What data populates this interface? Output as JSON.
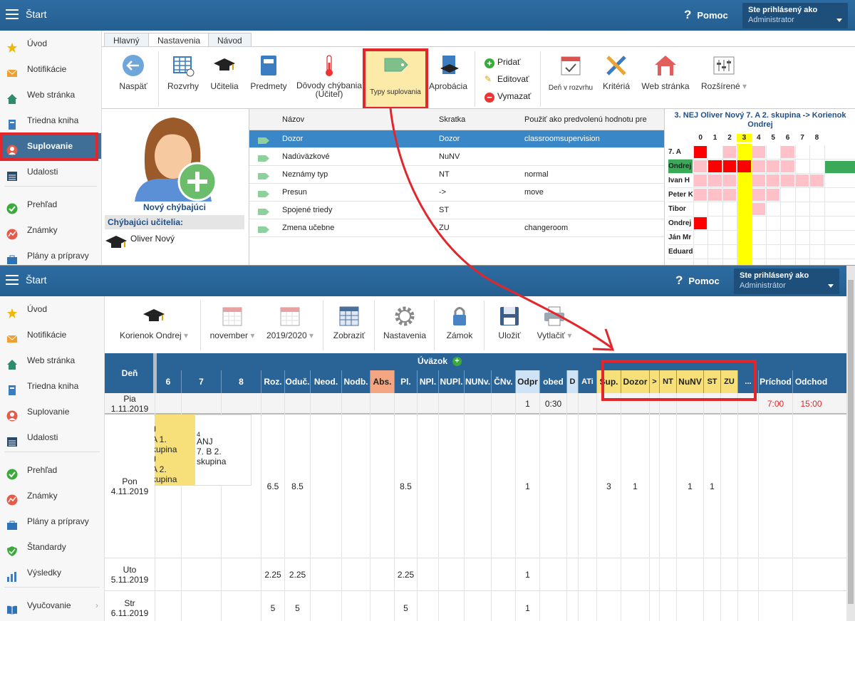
{
  "top": {
    "header": {
      "title": "Štart",
      "help": "Pomoc",
      "login_line1": "Ste prihlásený ako",
      "login_line2": "Administrator"
    },
    "sidebar": [
      {
        "label": "Úvod",
        "icon": "star-icon"
      },
      {
        "label": "Notifikácie",
        "icon": "envelope-icon"
      },
      {
        "label": "Web stránka",
        "icon": "home-icon"
      },
      {
        "label": "Triedna kniha",
        "icon": "book-icon"
      },
      {
        "label": "Suplovanie",
        "icon": "user-icon"
      },
      {
        "label": "Udalosti",
        "icon": "calendar-icon"
      },
      {
        "label": "Prehľad",
        "icon": "check-icon"
      },
      {
        "label": "Známky",
        "icon": "chart-icon"
      },
      {
        "label": "Plány a prípravy",
        "icon": "briefcase-icon"
      }
    ],
    "tabs": [
      "Hlavný",
      "Nastavenia",
      "Návod"
    ],
    "toolbar": {
      "back": "Naspäť",
      "schedules": "Rozvrhy",
      "teachers": "Učitelia",
      "subjects": "Predmety",
      "absence_reasons": "Dôvody chýbania (Učiteľ)",
      "sub_types": "Typy suplovania",
      "approbation": "Aprobácia",
      "add": "Pridať",
      "edit": "Editovať",
      "delete": "Vymazať",
      "day_in_schedule": "Deň v rozvrhu",
      "criteria": "Kritériá",
      "website": "Web stránka",
      "advanced": "Rozšírené"
    },
    "new_absent": "Nový chýbajúci",
    "absent_teachers_label": "Chýbajúci učitelia:",
    "absent_teacher": "Oliver Nový",
    "types_table": {
      "headers": [
        "Názov",
        "Skratka",
        "Použiť ako predvolenú hodnotu pre"
      ],
      "rows": [
        [
          "Dozor",
          "Dozor",
          "classroomsupervision"
        ],
        [
          "Nadúväzkové",
          "NuNV",
          ""
        ],
        [
          "Neznámy typ",
          "NT",
          "normal"
        ],
        [
          "Presun",
          "->",
          "move"
        ],
        [
          "Spojené triedy",
          "ST",
          ""
        ],
        [
          "Zmena učebne",
          "ZU",
          "changeroom"
        ]
      ]
    },
    "schedule_panel": {
      "title": "3. NEJ Oliver Nový 7. A 2. skupina -> Korienok Ondrej",
      "periods": [
        "0",
        "1",
        "2",
        "3",
        "4",
        "5",
        "6",
        "7",
        "8"
      ],
      "rows": [
        "7. A",
        "Ondrej",
        "Ivan H",
        "Peter K",
        "Tibor",
        "Ondrej",
        "Ján Mr",
        "Eduard"
      ]
    }
  },
  "bottom": {
    "header": {
      "title": "Štart",
      "help": "Pomoc",
      "login_line1": "Ste prihlásený ako",
      "login_line2": "Administrátor"
    },
    "sidebar": [
      {
        "label": "Úvod",
        "icon": "star-icon"
      },
      {
        "label": "Notifikácie",
        "icon": "envelope-icon"
      },
      {
        "label": "Web stránka",
        "icon": "home-icon"
      },
      {
        "label": "Triedna kniha",
        "icon": "book-icon"
      },
      {
        "label": "Suplovanie",
        "icon": "user-icon"
      },
      {
        "label": "Udalosti",
        "icon": "calendar-icon"
      },
      {
        "label": "Prehľad",
        "icon": "check-icon"
      },
      {
        "label": "Známky",
        "icon": "chart-icon"
      },
      {
        "label": "Plány a prípravy",
        "icon": "briefcase-icon"
      },
      {
        "label": "Štandardy",
        "icon": "shield-icon"
      },
      {
        "label": "Výsledky",
        "icon": "bar-chart-icon"
      },
      {
        "label": "Vyučovanie",
        "icon": "open-book-icon"
      }
    ],
    "toolbar": {
      "teacher": "Korienok Ondrej",
      "month": "november",
      "year": "2019/2020",
      "show": "Zobraziť",
      "settings": "Nastavenia",
      "lock": "Zámok",
      "save": "Uložiť",
      "print": "Vytlačiť"
    },
    "table": {
      "day_header": "Deň",
      "workload_header": "Úväzok",
      "period_headers": [
        "6",
        "7",
        "8"
      ],
      "columns": [
        "Roz.",
        "Oduč.",
        "Neod.",
        "Nodb.",
        "Abs.",
        "Pl.",
        "NPl.",
        "NUPl.",
        "NUNv.",
        "ČNv.",
        "Odpr",
        "obed",
        "D",
        "ATi",
        "Sup.",
        "Dozor",
        ">",
        "NT",
        "NuNV",
        "ST",
        "ZU",
        "...",
        "Príchod",
        "Odchod"
      ],
      "rows": [
        {
          "day": "Pia",
          "date": "1.11.2019",
          "cells": [
            "",
            "",
            "",
            "",
            "",
            "",
            "",
            "",
            "",
            "",
            "1",
            "0:30",
            "",
            "",
            "",
            "",
            "",
            "",
            "",
            "",
            "",
            "",
            "7:00",
            "15:00"
          ]
        },
        {
          "day": "Pon",
          "date": "4.11.2019",
          "cells": [
            "6.5",
            "8.5",
            "",
            "",
            "",
            "8.5",
            "",
            "",
            "",
            "",
            "1",
            "",
            "",
            "",
            "3",
            "1",
            "",
            "",
            "1",
            "1",
            "",
            "",
            "",
            ""
          ]
        },
        {
          "day": "Uto",
          "date": "5.11.2019",
          "cells": [
            "2.25",
            "2.25",
            "",
            "",
            "",
            "2.25",
            "",
            "",
            "",
            "",
            "1",
            "",
            "",
            "",
            "",
            "",
            "",
            "",
            "",
            "",
            "",
            "",
            "",
            ""
          ]
        },
        {
          "day": "Str",
          "date": "6.11.2019",
          "cells": [
            "5",
            "5",
            "",
            "",
            "",
            "5",
            "",
            "",
            "",
            "",
            "1",
            "",
            "",
            "",
            "",
            "",
            "",
            "",
            "",
            "",
            "",
            "",
            "",
            ""
          ]
        }
      ],
      "lesson_yellow": [
        "J",
        "A 1.",
        "kupina",
        "J",
        "A 2.",
        "kupina"
      ],
      "lesson_white": [
        "4",
        "ANJ",
        "7. B 2.",
        "skupina"
      ]
    }
  },
  "colors": {
    "header": "#2a6496",
    "red_highlight": "#e3262c",
    "selected_row": "#3a87c8",
    "yellow": "#f7e07a"
  }
}
